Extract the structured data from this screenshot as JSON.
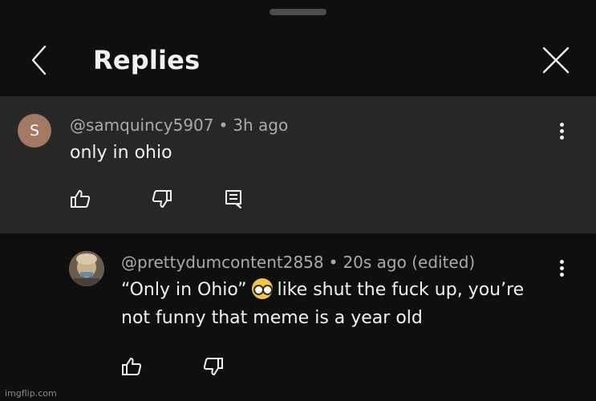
{
  "header": {
    "title": "Replies"
  },
  "parent_comment": {
    "avatar_letter": "S",
    "author": "@samquincy5907",
    "separator": "•",
    "time": "3h ago",
    "text": "only in ohio"
  },
  "reply": {
    "author": "@prettydumcontent2858",
    "separator": "•",
    "time": "20s ago (edited)",
    "text_part1": "“Only in Ohio”",
    "text_part2": "like shut the fuck up, you’re",
    "text_line2": "not funny that meme is a year old"
  },
  "watermark": "imgflip.com",
  "colors": {
    "background": "#0f0f0f",
    "highlight": "#272727",
    "meta_text": "#aaaaaa",
    "avatar_s": "#a47863"
  },
  "icons": [
    "back-chevron-icon",
    "close-icon",
    "more-vert-icon",
    "thumb-up-icon",
    "thumb-down-icon",
    "reply-comment-icon",
    "nerd-face-emoji"
  ]
}
